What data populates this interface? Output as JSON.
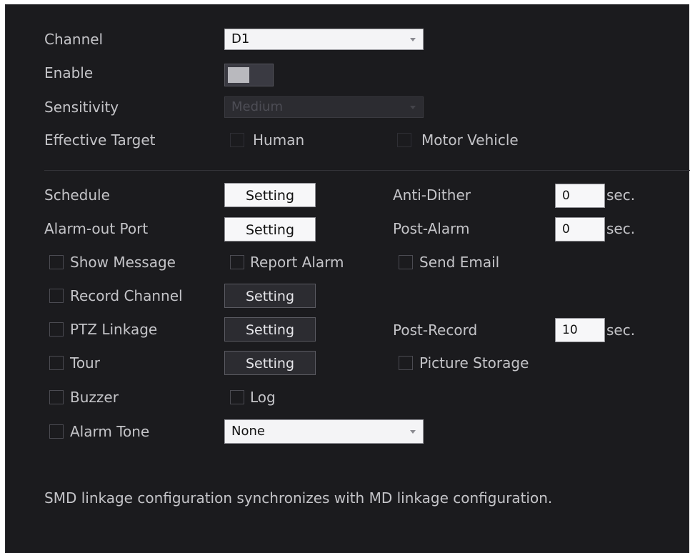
{
  "channel": {
    "label": "Channel",
    "value": "D1"
  },
  "enable": {
    "label": "Enable"
  },
  "sensitivity": {
    "label": "Sensitivity",
    "value": "Medium"
  },
  "effective_target": {
    "label": "Effective Target",
    "human": "Human",
    "motor_vehicle": "Motor Vehicle"
  },
  "schedule": {
    "label": "Schedule",
    "button": "Setting"
  },
  "anti_dither": {
    "label": "Anti-Dither",
    "value": "0",
    "unit": "sec."
  },
  "alarm_out_port": {
    "label": "Alarm-out Port",
    "button": "Setting"
  },
  "post_alarm": {
    "label": "Post-Alarm",
    "value": "0",
    "unit": "sec."
  },
  "show_message": {
    "label": "Show Message"
  },
  "report_alarm": {
    "label": "Report Alarm"
  },
  "send_email": {
    "label": "Send Email"
  },
  "record_channel": {
    "label": "Record Channel",
    "button": "Setting"
  },
  "ptz_linkage": {
    "label": "PTZ Linkage",
    "button": "Setting"
  },
  "post_record": {
    "label": "Post-Record",
    "value": "10",
    "unit": "sec."
  },
  "tour": {
    "label": "Tour",
    "button": "Setting"
  },
  "picture_storage": {
    "label": "Picture Storage"
  },
  "buzzer": {
    "label": "Buzzer"
  },
  "log": {
    "label": "Log"
  },
  "alarm_tone": {
    "label": "Alarm Tone",
    "value": "None"
  },
  "note": "SMD linkage configuration synchronizes with MD linkage configuration.",
  "colors": {
    "panel_bg": "#1b1b1e",
    "text": "#c4c4c8",
    "input_bg": "#f4f4f6",
    "dark_button_bg": "#2c2c31"
  }
}
